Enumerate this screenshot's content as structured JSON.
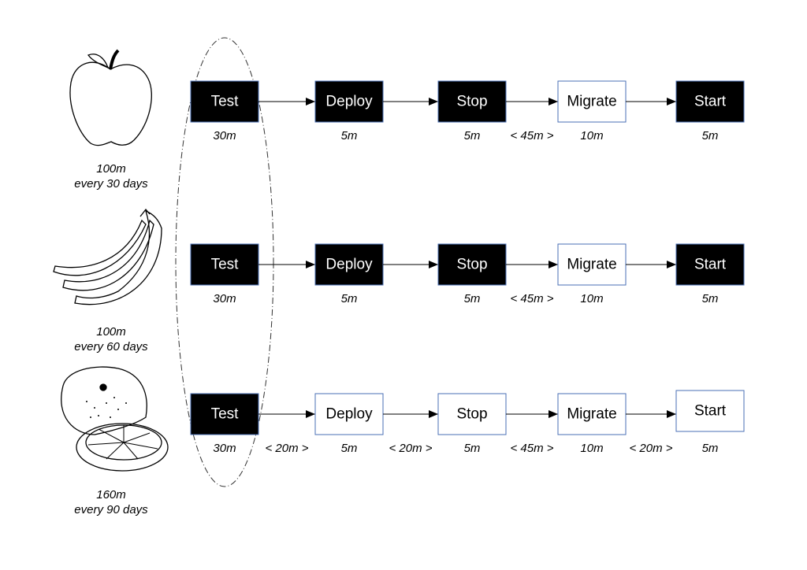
{
  "colors": {
    "filled": "#000000",
    "outline": "#4a6fb5",
    "arrow": "#000000"
  },
  "rows": [
    {
      "fruit": "apple",
      "fruit_icon": "apple-icon",
      "size": "100m",
      "interval": "every 30 days",
      "steps": [
        {
          "label": "Test",
          "filled": true,
          "duration": "30m"
        },
        {
          "label": "Deploy",
          "filled": true,
          "duration": "5m"
        },
        {
          "label": "Stop",
          "filled": true,
          "duration": "5m"
        },
        {
          "label": "Migrate",
          "filled": false,
          "duration": "10m"
        },
        {
          "label": "Start",
          "filled": true,
          "duration": "5m"
        }
      ],
      "gaps": [
        "",
        "",
        "< 45m >",
        ""
      ]
    },
    {
      "fruit": "banana",
      "fruit_icon": "banana-icon",
      "size": "100m",
      "interval": "every 60 days",
      "steps": [
        {
          "label": "Test",
          "filled": true,
          "duration": "30m"
        },
        {
          "label": "Deploy",
          "filled": true,
          "duration": "5m"
        },
        {
          "label": "Stop",
          "filled": true,
          "duration": "5m"
        },
        {
          "label": "Migrate",
          "filled": false,
          "duration": "10m"
        },
        {
          "label": "Start",
          "filled": true,
          "duration": "5m"
        }
      ],
      "gaps": [
        "",
        "",
        "< 45m >",
        ""
      ]
    },
    {
      "fruit": "orange",
      "fruit_icon": "orange-icon",
      "size": "160m",
      "interval": "every 90 days",
      "steps": [
        {
          "label": "Test",
          "filled": true,
          "duration": "30m"
        },
        {
          "label": "Deploy",
          "filled": false,
          "duration": "5m"
        },
        {
          "label": "Stop",
          "filled": false,
          "duration": "5m"
        },
        {
          "label": "Migrate",
          "filled": false,
          "duration": "10m"
        },
        {
          "label": "Start",
          "filled": false,
          "duration": "5m"
        }
      ],
      "gaps": [
        "< 20m >",
        "< 20m >",
        "< 45m >",
        "< 20m >"
      ]
    }
  ]
}
